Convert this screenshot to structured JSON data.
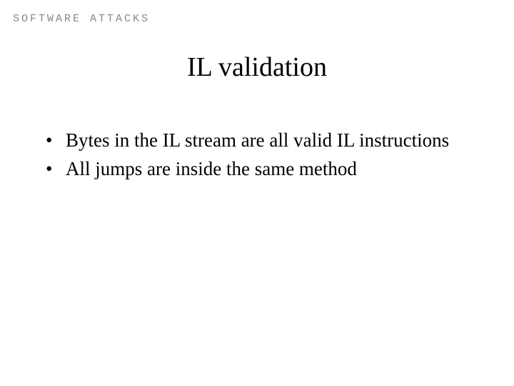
{
  "header": {
    "label": "Software attacks"
  },
  "slide": {
    "title": "IL validation",
    "bullets": [
      "Bytes in the IL stream are all valid IL instructions",
      "All jumps are inside the same method"
    ]
  }
}
